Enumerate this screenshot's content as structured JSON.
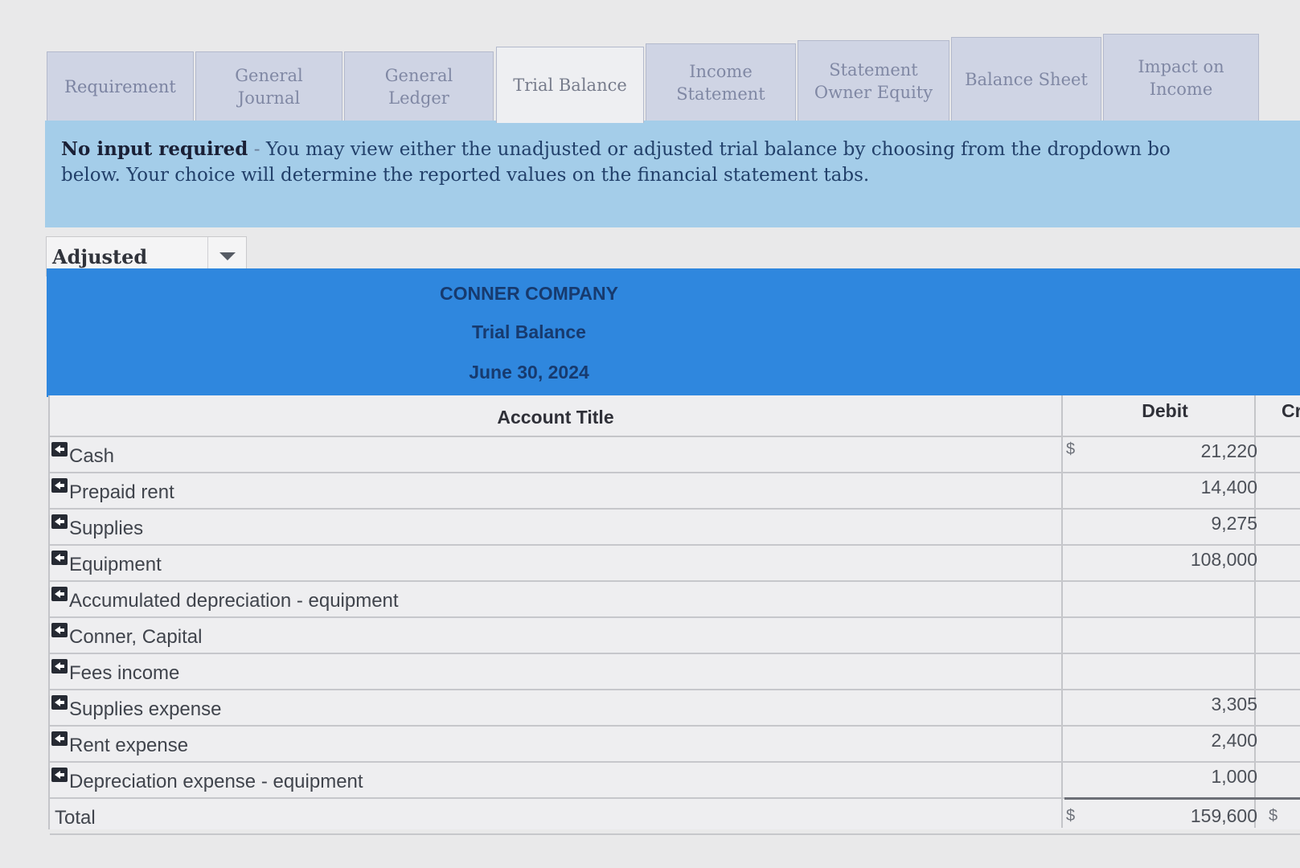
{
  "tabs": [
    {
      "label": "Requirement"
    },
    {
      "label": "General\nJournal"
    },
    {
      "label": "General\nLedger"
    },
    {
      "label": "Trial Balance"
    },
    {
      "label": "Income\nStatement"
    },
    {
      "label": "Statement\nOwner Equity"
    },
    {
      "label": "Balance Sheet"
    },
    {
      "label": "Impact on\nIncome"
    }
  ],
  "active_tab": "Trial Balance",
  "info": {
    "lead": "No input required",
    "separator": "-",
    "line1": "You may view either the unadjusted or adjusted trial balance by choosing from the dropdown bo",
    "line2": "below.  Your choice will determine the reported values on the financial statement tabs."
  },
  "view_select": {
    "value": "Adjusted"
  },
  "header": {
    "company": "CONNER COMPANY",
    "title": "Trial Balance",
    "date": "June 30, 2024"
  },
  "columns": {
    "title": "Account Title",
    "debit": "Debit",
    "credit": "Cr"
  },
  "rows": [
    {
      "title": "Cash",
      "dollar": "$",
      "debit": "21,220"
    },
    {
      "title": "Prepaid rent",
      "dollar": "",
      "debit": "14,400"
    },
    {
      "title": "Supplies",
      "dollar": "",
      "debit": "9,275"
    },
    {
      "title": "Equipment",
      "dollar": "",
      "debit": "108,000"
    },
    {
      "title": "Accumulated depreciation - equipment",
      "dollar": "",
      "debit": ""
    },
    {
      "title": "Conner, Capital",
      "dollar": "",
      "debit": ""
    },
    {
      "title": "Fees income",
      "dollar": "",
      "debit": ""
    },
    {
      "title": "Supplies expense",
      "dollar": "",
      "debit": "3,305"
    },
    {
      "title": "Rent expense",
      "dollar": "",
      "debit": "2,400"
    },
    {
      "title": "Depreciation expense - equipment",
      "dollar": "",
      "debit": "1,000"
    }
  ],
  "total": {
    "label": "Total",
    "dollar": "$",
    "debit": "159,600",
    "credit_dollar": "$"
  },
  "colors": {
    "banner": "#a4cde9",
    "header_band": "#2f87de",
    "tab_inactive": "#cfd4e4",
    "tab_active": "#eeeff2"
  }
}
